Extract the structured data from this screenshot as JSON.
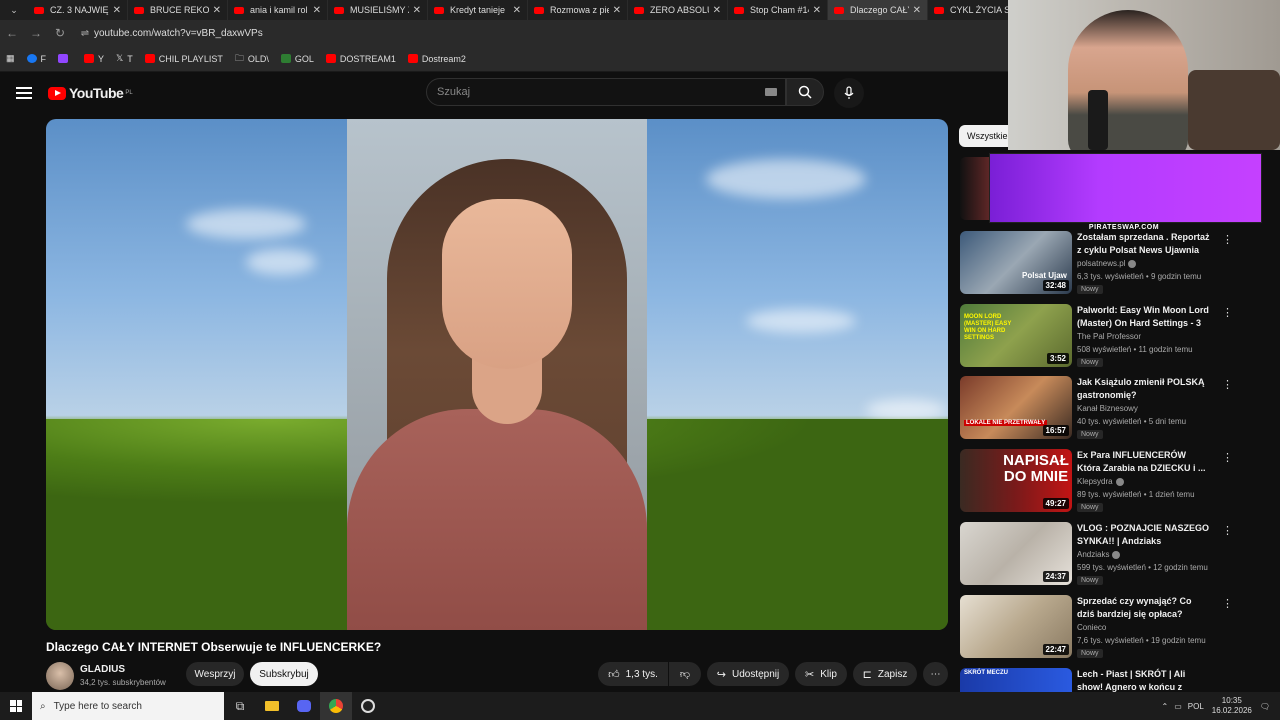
{
  "browser": {
    "tabs": [
      {
        "title": "CZ. 3 NAJWIĘK"
      },
      {
        "title": "BRUCE REKORD"
      },
      {
        "title": "ania i kamil rol"
      },
      {
        "title": "MUSIELIŚMY Z"
      },
      {
        "title": "Kredyt tanieje"
      },
      {
        "title": "Rozmowa z pie"
      },
      {
        "title": "ZERO ABSOLUT"
      },
      {
        "title": "Stop Cham #14"
      },
      {
        "title": "Dlaczego CAŁY"
      },
      {
        "title": "CYKL ŻYCIA SA"
      }
    ],
    "url": "youtube.com/watch?v=vBR_daxwVPs",
    "bookmarks": [
      {
        "label": "F",
        "color": "#1877f2"
      },
      {
        "label": "",
        "color": "#9146ff"
      },
      {
        "label": "Y",
        "color": "#ff0000"
      },
      {
        "label": "T",
        "color": "#000000"
      },
      {
        "label": "CHIL PLAYLIST",
        "color": "#ff0000"
      },
      {
        "label": "OLD\\",
        "color": "folder"
      },
      {
        "label": "GOL",
        "color": "#2e7d32"
      },
      {
        "label": "DOSTREAM1",
        "color": "#ff0000"
      },
      {
        "label": "Dostream2",
        "color": "#ff0000"
      }
    ]
  },
  "youtube": {
    "logo": "YouTube",
    "region": "PL",
    "search_placeholder": "Szukaj"
  },
  "video": {
    "title": "Dlaczego CAŁY INTERNET Obserwuje te INFLUENCERKE?",
    "channel": "GLADIUS",
    "subs": "34,2 tys. subskrybentów",
    "support": "Wesprzyj",
    "subscribe": "Subskrybuj",
    "likes": "1,3 tys.",
    "share": "Udostępnij",
    "clip": "Klip",
    "save": "Zapisz"
  },
  "sidebar": {
    "chip": "Wszystkie",
    "promo_label": "PIRATESWAP.COM",
    "items": [
      {
        "title": "Zostałam sprzedana . Reportaż z cyklu Polsat News Ujawnia",
        "channel": "polsatnews.pl",
        "meta": "6,3 tys. wyświetleń • 9 godzin temu",
        "badge": "Nowy",
        "duration": "32:48",
        "verified": true
      },
      {
        "title": "Palworld: Easy Win Moon Lord (Master) On Hard Settings - 3 ...",
        "channel": "The Pal Professor",
        "meta": "508 wyświetleń • 11 godzin temu",
        "badge": "Nowy",
        "duration": "3:52",
        "verified": false
      },
      {
        "title": "Jak Książulo zmienił POLSKĄ gastronomię?",
        "channel": "Kanał Biznesowy",
        "meta": "40 tys. wyświetleń • 5 dni temu",
        "badge": "Nowy",
        "duration": "16:57",
        "verified": false
      },
      {
        "title": "Ex Para INFLUENCERÓW Która Zarabia na DZIECKU i ...",
        "channel": "Klepsydra",
        "meta": "89 tys. wyświetleń • 1 dzień temu",
        "badge": "Nowy",
        "duration": "49:27",
        "verified": true
      },
      {
        "title": "VLOG : POZNAJCIE NASZEGO SYNKA!! | Andziaks",
        "channel": "Andziaks",
        "meta": "599 tys. wyświetleń • 12 godzin temu",
        "badge": "Nowy",
        "duration": "24:37",
        "verified": true
      },
      {
        "title": "Sprzedać czy wynająć? Co dziś bardziej się opłaca?",
        "channel": "Conieco",
        "meta": "7,6 tys. wyświetleń • 19 godzin temu",
        "badge": "Nowy",
        "duration": "22:47",
        "verified": false
      },
      {
        "title": "Lech - Piast | SKRÓT | Ali show! Agnero w końcu z golem! | ...",
        "channel": "",
        "meta": "",
        "badge": "",
        "duration": "",
        "verified": false
      }
    ],
    "thumb_texts": [
      "Polsat Ujaw",
      "MOON LORD (MASTER) EASY WIN ON HARD SETTINGS",
      "LOKALE NIE PRZETRWAŁY",
      "NAPISAŁ DO MNIE",
      "",
      "",
      "SKRÓT MECZU"
    ]
  },
  "taskbar": {
    "search_placeholder": "Type here to search",
    "lang": "POL",
    "time": "10:35",
    "date": "16.02.2026"
  }
}
